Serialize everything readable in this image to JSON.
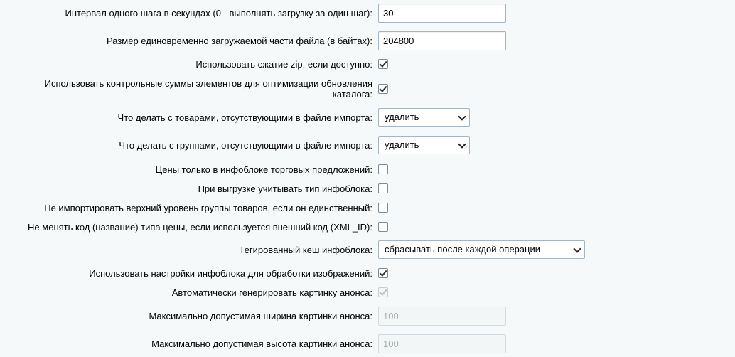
{
  "fields": [
    {
      "label": "Интервал одного шага в секундах (0 - выполнять загрузку за один шаг):",
      "type": "text",
      "value": "30"
    },
    {
      "label": "Размер единовременно загружаемой части файла (в байтах):",
      "type": "text",
      "value": "204800"
    },
    {
      "label": "Использовать сжатие zip, если доступно:",
      "type": "checkbox",
      "checked": true
    },
    {
      "label": "Использовать контрольные суммы элементов для оптимизации обновления каталога:",
      "type": "checkbox",
      "checked": true
    },
    {
      "label": "Что делать с товарами, отсутствующими в файле импорта:",
      "type": "select",
      "value": "удалить"
    },
    {
      "label": "Что делать с группами, отсутствующими в файле импорта:",
      "type": "select",
      "value": "удалить"
    },
    {
      "label": "Цены только в инфоблоке торговых предложений:",
      "type": "checkbox",
      "checked": false
    },
    {
      "label": "При выгрузке учитывать тип инфоблока:",
      "type": "checkbox",
      "checked": false
    },
    {
      "label": "Не импортировать верхний уровень группы товаров, если он единственный:",
      "type": "checkbox",
      "checked": false
    },
    {
      "label": "Не менять код (название) типа цены, если используется внешний код (XML_ID):",
      "type": "checkbox",
      "checked": false
    },
    {
      "label": "Тегированный кеш инфоблока:",
      "type": "select",
      "value": "сбрасывать после каждой операции"
    },
    {
      "label": "Использовать настройки инфоблока для обработки изображений:",
      "type": "checkbox",
      "checked": true
    },
    {
      "label": "Автоматически генерировать картинку анонса:",
      "type": "checkbox",
      "checked": true,
      "disabled": true
    },
    {
      "label": "Максимально допустимая ширина картинки анонса:",
      "type": "text",
      "value": "100",
      "disabled": true
    },
    {
      "label": "Максимально допустимая высота картинки анонса:",
      "type": "text",
      "value": "100",
      "disabled": true
    }
  ]
}
